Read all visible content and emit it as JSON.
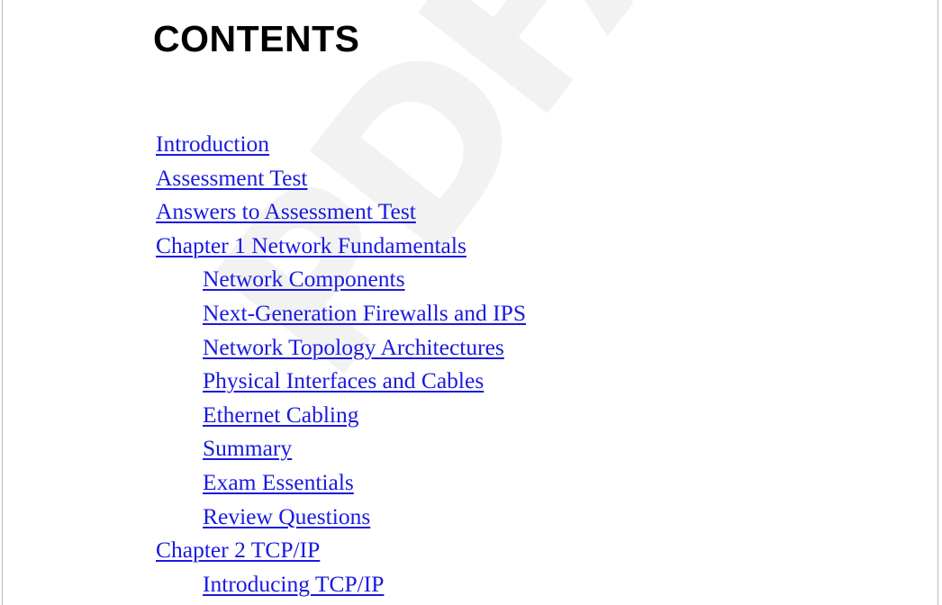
{
  "document": {
    "title": "CONTENTS",
    "watermark": "PDFAway",
    "link_color": "#1a1ae0",
    "title_color": "#000000",
    "watermark_color": "#f2f2f3",
    "page_background": "#ffffff"
  },
  "toc": {
    "entries": [
      {
        "label": "Introduction",
        "level": 0
      },
      {
        "label": "Assessment Test",
        "level": 0
      },
      {
        "label": "Answers to Assessment Test",
        "level": 0
      },
      {
        "label": "Chapter 1 Network Fundamentals",
        "level": 0
      },
      {
        "label": "Network Components",
        "level": 1
      },
      {
        "label": "Next-Generation Firewalls and IPS",
        "level": 1
      },
      {
        "label": "Network Topology Architectures",
        "level": 1
      },
      {
        "label": "Physical Interfaces and Cables",
        "level": 1
      },
      {
        "label": "Ethernet Cabling",
        "level": 1
      },
      {
        "label": "Summary",
        "level": 1
      },
      {
        "label": "Exam Essentials",
        "level": 1
      },
      {
        "label": "Review Questions",
        "level": 1
      },
      {
        "label": "Chapter 2 TCP/IP",
        "level": 0
      },
      {
        "label": "Introducing TCP/IP",
        "level": 1
      }
    ]
  }
}
